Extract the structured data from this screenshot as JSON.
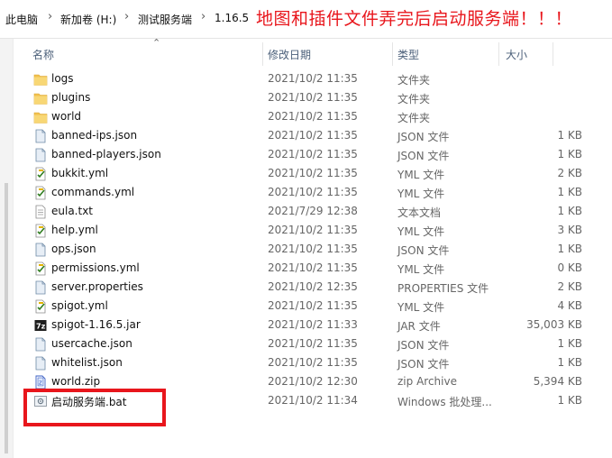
{
  "breadcrumb": {
    "items": [
      "此电脑",
      "新加卷 (H:)",
      "测试服务端",
      "1.16.5"
    ],
    "separator": "›"
  },
  "annotation": "地图和插件文件弄完后启动服务端！！！",
  "columns": {
    "name": "名称",
    "date": "修改日期",
    "type": "类型",
    "size": "大小"
  },
  "files": [
    {
      "name": "logs",
      "date": "2021/10/2 11:35",
      "type": "文件夹",
      "size": "",
      "icon": "folder-icon"
    },
    {
      "name": "plugins",
      "date": "2021/10/2 11:35",
      "type": "文件夹",
      "size": "",
      "icon": "folder-icon"
    },
    {
      "name": "world",
      "date": "2021/10/2 11:35",
      "type": "文件夹",
      "size": "",
      "icon": "folder-icon"
    },
    {
      "name": "banned-ips.json",
      "date": "2021/10/2 11:35",
      "type": "JSON 文件",
      "size": "1 KB",
      "icon": "json-file-icon"
    },
    {
      "name": "banned-players.json",
      "date": "2021/10/2 11:35",
      "type": "JSON 文件",
      "size": "1 KB",
      "icon": "json-file-icon"
    },
    {
      "name": "bukkit.yml",
      "date": "2021/10/2 11:35",
      "type": "YML 文件",
      "size": "2 KB",
      "icon": "yml-file-icon"
    },
    {
      "name": "commands.yml",
      "date": "2021/10/2 11:35",
      "type": "YML 文件",
      "size": "1 KB",
      "icon": "yml-file-icon"
    },
    {
      "name": "eula.txt",
      "date": "2021/7/29 12:38",
      "type": "文本文档",
      "size": "1 KB",
      "icon": "text-file-icon"
    },
    {
      "name": "help.yml",
      "date": "2021/10/2 11:35",
      "type": "YML 文件",
      "size": "3 KB",
      "icon": "yml-file-icon"
    },
    {
      "name": "ops.json",
      "date": "2021/10/2 11:35",
      "type": "JSON 文件",
      "size": "1 KB",
      "icon": "json-file-icon"
    },
    {
      "name": "permissions.yml",
      "date": "2021/10/2 11:35",
      "type": "YML 文件",
      "size": "0 KB",
      "icon": "yml-file-icon"
    },
    {
      "name": "server.properties",
      "date": "2021/10/2 12:35",
      "type": "PROPERTIES 文件",
      "size": "2 KB",
      "icon": "properties-file-icon"
    },
    {
      "name": "spigot.yml",
      "date": "2021/10/2 11:35",
      "type": "YML 文件",
      "size": "4 KB",
      "icon": "yml-file-icon"
    },
    {
      "name": "spigot-1.16.5.jar",
      "date": "2021/10/2 11:33",
      "type": "JAR 文件",
      "size": "35,003 KB",
      "icon": "jar-file-icon"
    },
    {
      "name": "usercache.json",
      "date": "2021/10/2 11:35",
      "type": "JSON 文件",
      "size": "1 KB",
      "icon": "json-file-icon"
    },
    {
      "name": "whitelist.json",
      "date": "2021/10/2 11:35",
      "type": "JSON 文件",
      "size": "1 KB",
      "icon": "json-file-icon"
    },
    {
      "name": "world.zip",
      "date": "2021/10/2 12:30",
      "type": "zip Archive",
      "size": "5,394 KB",
      "icon": "zip-file-icon"
    },
    {
      "name": "启动服务端.bat",
      "date": "2021/10/2 11:34",
      "type": "Windows 批处理...",
      "size": "1 KB",
      "icon": "bat-file-icon"
    }
  ],
  "colors": {
    "annotation": "#e8161c",
    "folder": "#f2c14e",
    "header_text": "#4c607a"
  }
}
